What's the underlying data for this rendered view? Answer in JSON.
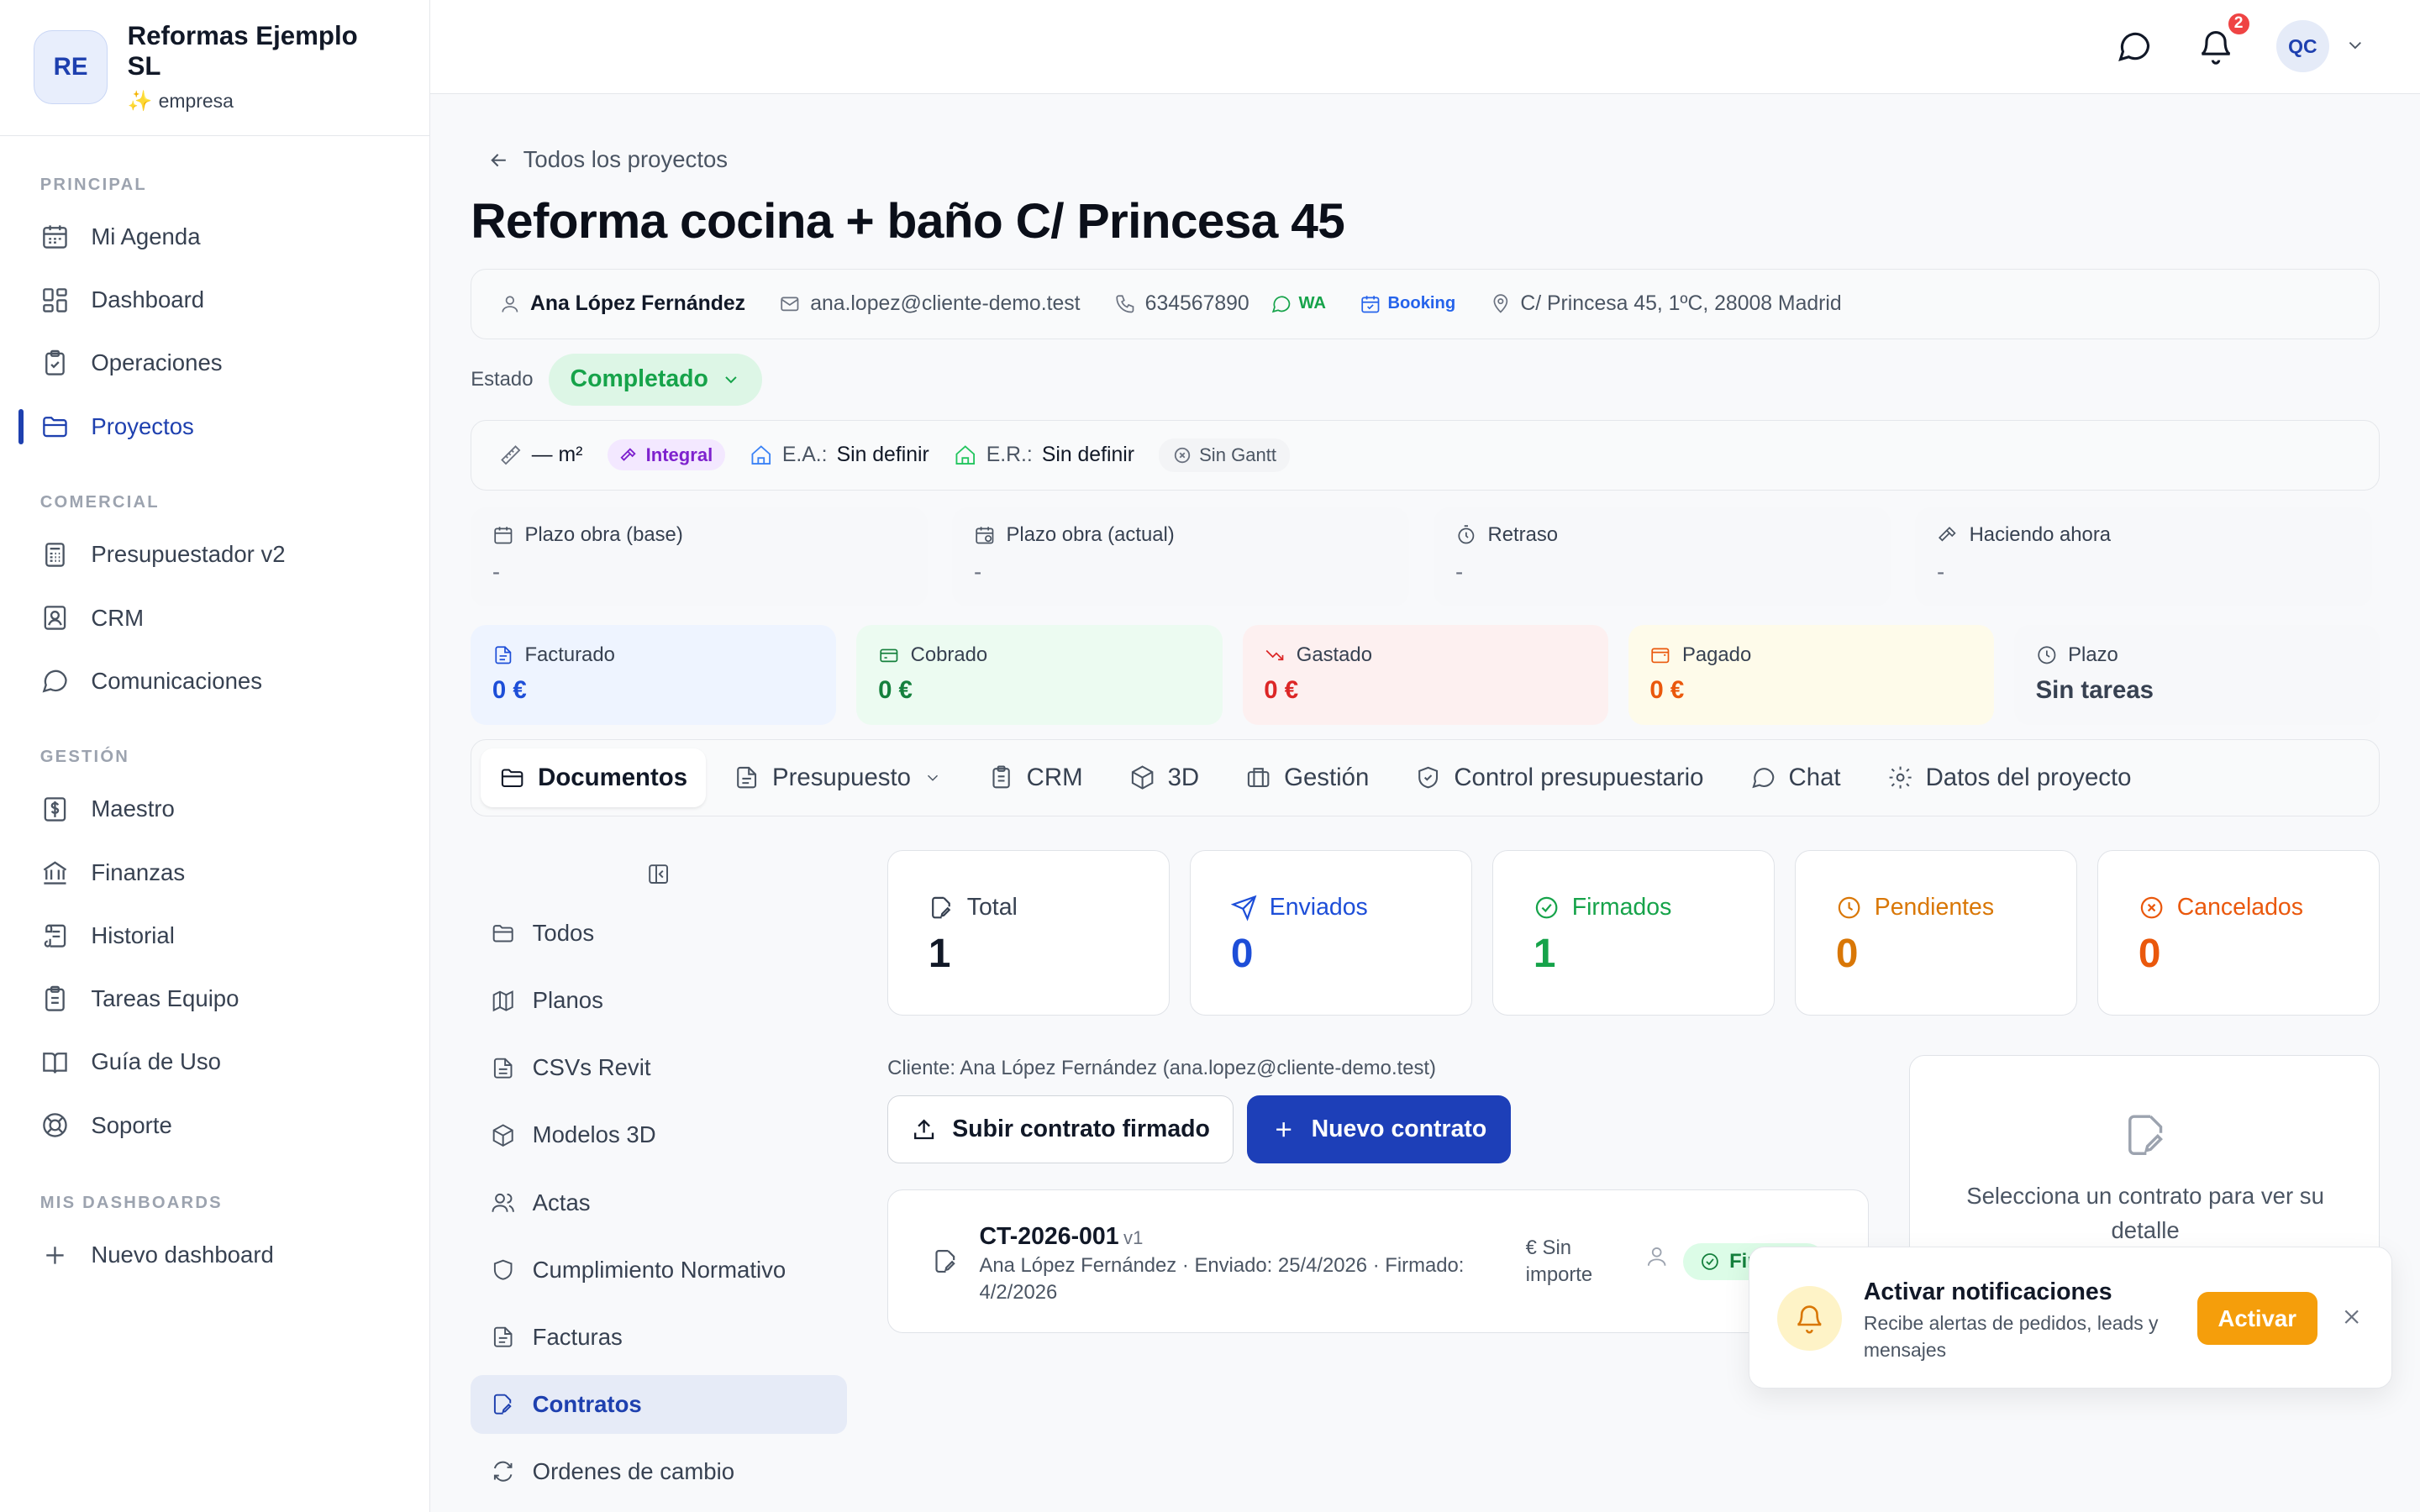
{
  "org": {
    "initials": "RE",
    "name": "Reformas Ejemplo SL",
    "plan": "empresa"
  },
  "sidebar": {
    "sections": [
      {
        "title": "PRINCIPAL",
        "items": [
          {
            "label": "Mi Agenda",
            "icon": "calendar-icon"
          },
          {
            "label": "Dashboard",
            "icon": "dashboard-icon"
          },
          {
            "label": "Operaciones",
            "icon": "clipboard-icon"
          },
          {
            "label": "Proyectos",
            "icon": "folder-icon",
            "active": true
          }
        ]
      },
      {
        "title": "COMERCIAL",
        "items": [
          {
            "label": "Presupuestador v2",
            "icon": "calculator-icon"
          },
          {
            "label": "CRM",
            "icon": "contact-icon"
          },
          {
            "label": "Comunicaciones",
            "icon": "chat-icon"
          }
        ]
      },
      {
        "title": "GESTIÓN",
        "items": [
          {
            "label": "Maestro",
            "icon": "dollar-doc-icon"
          },
          {
            "label": "Finanzas",
            "icon": "bank-icon"
          },
          {
            "label": "Historial",
            "icon": "scroll-icon"
          },
          {
            "label": "Tareas Equipo",
            "icon": "clipboard-list-icon"
          },
          {
            "label": "Guía de Uso",
            "icon": "book-icon"
          },
          {
            "label": "Soporte",
            "icon": "lifebuoy-icon"
          }
        ]
      },
      {
        "title": "MIS DASHBOARDS",
        "items": [
          {
            "label": "Nuevo dashboard",
            "icon": "plus-icon"
          }
        ]
      }
    ]
  },
  "topbar": {
    "notification_count": "2",
    "user_initials": "QC"
  },
  "project": {
    "back_label": "Todos los proyectos",
    "title": "Reforma cocina + baño C/ Princesa 45",
    "client": {
      "name": "Ana López Fernández",
      "email": "ana.lopez@cliente-demo.test",
      "phone": "634567890",
      "wa_label": "WA",
      "booking_label": "Booking",
      "address": "C/ Princesa 45, 1ºC, 28008 Madrid"
    },
    "estado_label": "Estado",
    "estado_value": "Completado",
    "specs": {
      "area": "— m²",
      "type": "Integral",
      "ea_label": "E.A.:",
      "ea_value": "Sin definir",
      "er_label": "E.R.:",
      "er_value": "Sin definir",
      "gantt": "Sin Gantt"
    },
    "kpis": [
      {
        "label": "Plazo obra (base)",
        "value": "-"
      },
      {
        "label": "Plazo obra (actual)",
        "value": "-"
      },
      {
        "label": "Retraso",
        "value": "-"
      },
      {
        "label": "Haciendo ahora",
        "value": "-"
      }
    ],
    "money": [
      {
        "label": "Facturado",
        "value": "0 €",
        "bg": "#eef4ff",
        "color": "#1d4ed8"
      },
      {
        "label": "Cobrado",
        "value": "0 €",
        "bg": "#ecfbf1",
        "color": "#15803d"
      },
      {
        "label": "Gastado",
        "value": "0 €",
        "bg": "#fdf0f0",
        "color": "#dc2626"
      },
      {
        "label": "Pagado",
        "value": "0 €",
        "bg": "#fefbea",
        "color": "#ea580c"
      },
      {
        "label": "Plazo",
        "value": "Sin tareas",
        "bg": "#f7f8fa",
        "color": "#374151"
      }
    ]
  },
  "tabs": [
    {
      "label": "Documentos",
      "active": true
    },
    {
      "label": "Presupuesto"
    },
    {
      "label": "CRM"
    },
    {
      "label": "3D"
    },
    {
      "label": "Gestión"
    },
    {
      "label": "Control presupuestario"
    },
    {
      "label": "Chat"
    },
    {
      "label": "Datos del proyecto"
    }
  ],
  "doc_nav": [
    {
      "label": "Todos"
    },
    {
      "label": "Planos"
    },
    {
      "label": "CSVs Revit"
    },
    {
      "label": "Modelos 3D"
    },
    {
      "label": "Actas"
    },
    {
      "label": "Cumplimiento Normativo"
    },
    {
      "label": "Facturas"
    },
    {
      "label": "Contratos",
      "active": true
    },
    {
      "label": "Ordenes de cambio"
    }
  ],
  "stats": [
    {
      "label": "Total",
      "value": "1",
      "color": "#111827",
      "label_color": "#374151"
    },
    {
      "label": "Enviados",
      "value": "0",
      "color": "#1d4ed8",
      "label_color": "#1d4ed8"
    },
    {
      "label": "Firmados",
      "value": "1",
      "color": "#16a34a",
      "label_color": "#16a34a"
    },
    {
      "label": "Pendientes",
      "value": "0",
      "color": "#d97706",
      "label_color": "#d97706"
    },
    {
      "label": "Cancelados",
      "value": "0",
      "color": "#ea580c",
      "label_color": "#ea580c"
    }
  ],
  "contracts": {
    "client_line": "Cliente: Ana López Fernández (ana.lopez@cliente-demo.test)",
    "upload_label": "Subir contrato firmado",
    "new_label": "Nuevo contrato",
    "items": [
      {
        "code": "CT-2026-001",
        "version": "v1",
        "meta": "Ana López Fernández · Enviado: 25/4/2026 · Firmado: 4/2/2026",
        "amount": "€ Sin importe",
        "status": "Firmado"
      }
    ],
    "empty_detail": "Selecciona un contrato para ver su detalle"
  },
  "toast": {
    "title": "Activar notificaciones",
    "body": "Recibe alertas de pedidos, leads y mensajes",
    "button": "Activar"
  }
}
